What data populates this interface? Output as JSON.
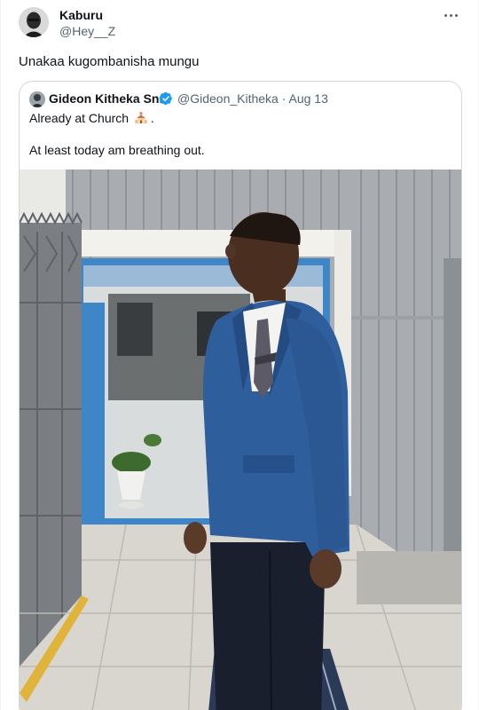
{
  "tweet": {
    "author_name": "Kaburu",
    "author_handle": "@Hey__Z",
    "text": "Unakaa kugombanisha mungu",
    "more_icon": "more-horizontal-icon"
  },
  "quoted_tweet": {
    "author_name": "Gideon Kitheka Snr",
    "author_handle": "@Gideon_Kitheka · Aug 13",
    "verified": true,
    "line1": "Already at Church",
    "line1_suffix": ".",
    "line2": "At least today am breathing out.",
    "emoji_icon": "church-icon"
  },
  "colors": {
    "text": "#0f1419",
    "secondary": "#536471",
    "border": "#cfd9de",
    "verified": "#1d9bf0",
    "door_blue": "#3f86c8",
    "suit_blue": "#2f5e9c"
  }
}
